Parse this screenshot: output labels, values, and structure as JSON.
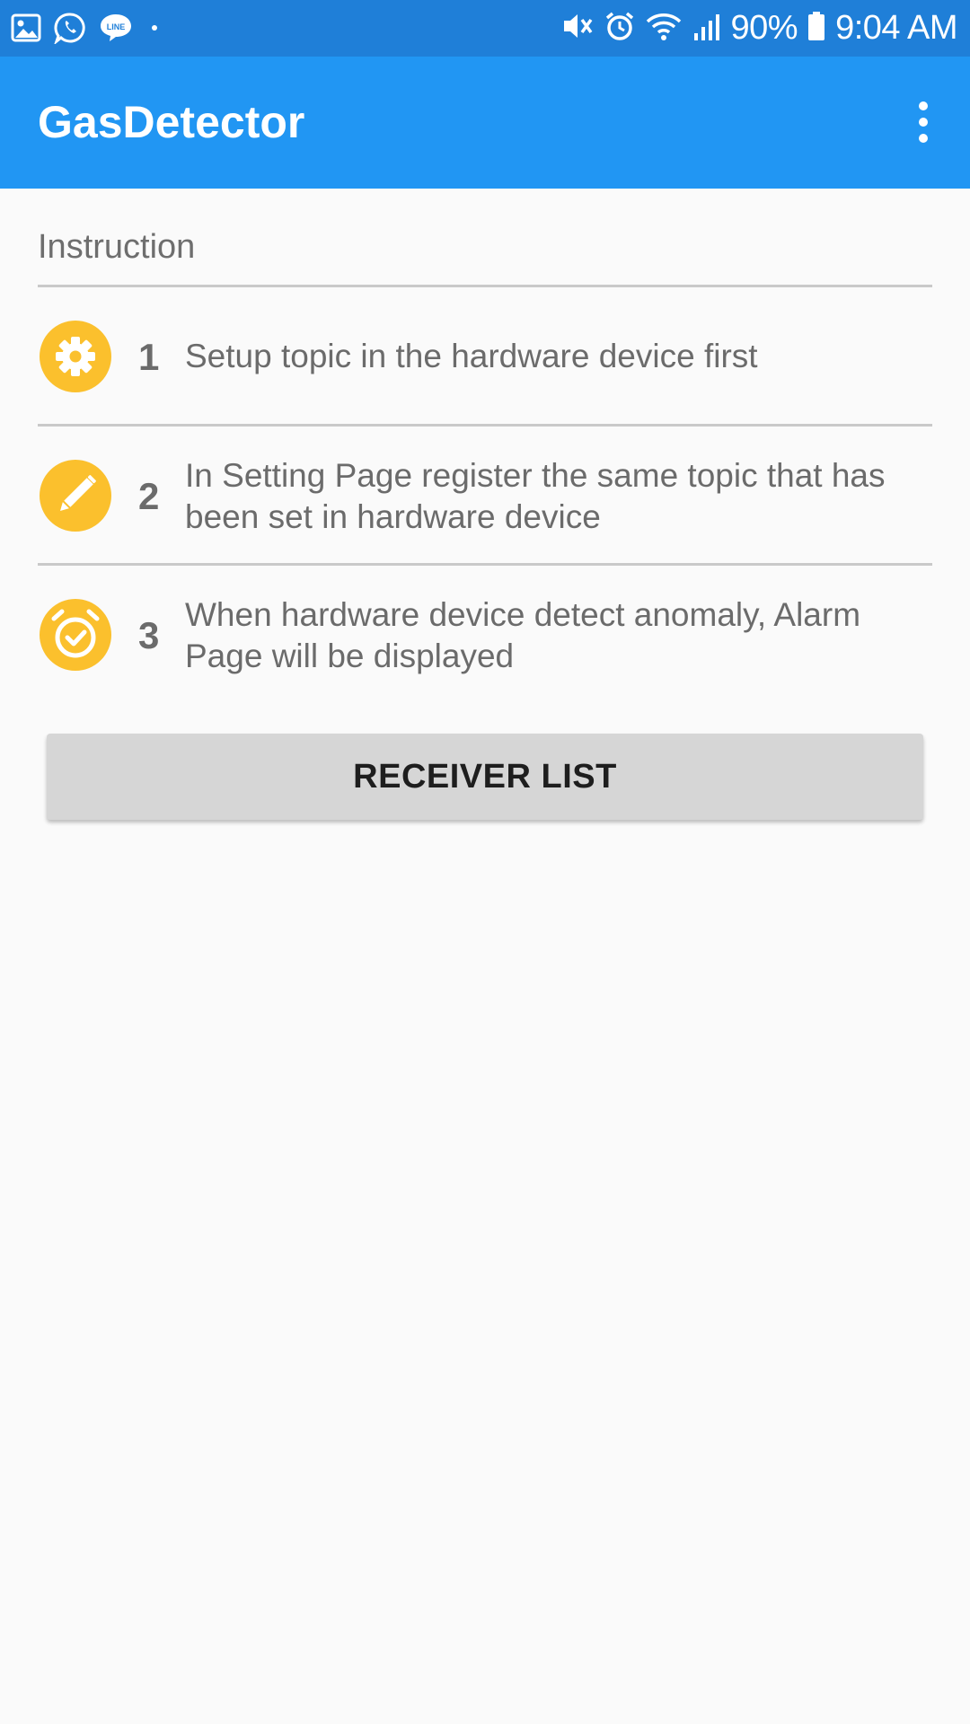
{
  "status_bar": {
    "battery_percent": "90%",
    "time": "9:04 AM",
    "left_icons": [
      "gallery-icon",
      "whatsapp-icon",
      "line-icon",
      "dot-icon"
    ],
    "right_icons": [
      "mute-icon",
      "alarm-icon",
      "wifi-icon",
      "signal-icon",
      "battery-icon"
    ]
  },
  "app_bar": {
    "title": "GasDetector",
    "menu_icon": "overflow-menu-icon"
  },
  "instructions": {
    "header": "Instruction",
    "items": [
      {
        "number": "1",
        "text": "Setup topic in the hardware device first",
        "icon": "gear-icon"
      },
      {
        "number": "2",
        "text": "In Setting Page register the same topic that has been set in hardware device",
        "icon": "pencil-icon"
      },
      {
        "number": "3",
        "text": "When hardware device detect anomaly, Alarm Page will be displayed",
        "icon": "alarm-check-icon"
      }
    ]
  },
  "receiver_button": {
    "label": "RECEIVER LIST"
  },
  "colors": {
    "status_bar": "#1f7fd8",
    "app_bar": "#2196f3",
    "icon_accent": "#fbc02d",
    "background": "#fafafa"
  }
}
